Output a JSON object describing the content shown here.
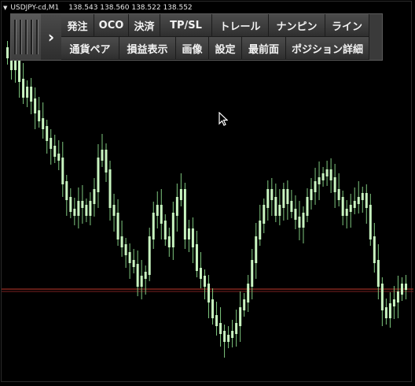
{
  "window": {
    "symbol_label": "USDJPY-cd,M1",
    "ohlc_values": "138.543 138.560 138.522 138.552"
  },
  "toolbar": {
    "row1": [
      "発注",
      "OCO",
      "決済",
      "TP/SL",
      "トレール",
      "ナンピン",
      "ライン"
    ],
    "row2": [
      "通貨ペア",
      "損益表示",
      "画像",
      "設定",
      "最前面",
      "ポジション詳細"
    ]
  },
  "colors": {
    "background": "#000000",
    "candle": "#c8f5c0",
    "wick": "#7fc87f",
    "price_line": "#c0392b",
    "toolbar_bg": "#3a3a3a",
    "toolbar_text": "#f2f2f2"
  },
  "icons": [
    "grip-handle-icon",
    "chevron-right-icon",
    "mouse-cursor-icon"
  ]
}
